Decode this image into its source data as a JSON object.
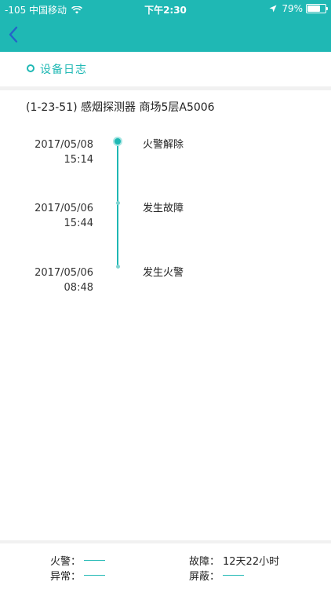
{
  "status_bar": {
    "carrier": "-105 中国移动",
    "time": "下午2:30",
    "battery": "79%",
    "battery_level": 0.79
  },
  "section": {
    "title": "设备日志"
  },
  "device": {
    "line": "(1-23-51) 感烟探测器 商场5层A5006"
  },
  "timeline": [
    {
      "date": "2017/05/08",
      "time": "15:14",
      "event": "火警解除"
    },
    {
      "date": "2017/05/06",
      "time": "15:44",
      "event": "发生故障"
    },
    {
      "date": "2017/05/06",
      "time": "08:48",
      "event": "发生火警"
    }
  ],
  "summary": {
    "fire_label": "火警：",
    "fault_label": "故障：",
    "fault_value": "12天22小时",
    "abnormal_label": "异常：",
    "shield_label": "屏蔽："
  },
  "colors": {
    "accent": "#1fb8b4"
  }
}
